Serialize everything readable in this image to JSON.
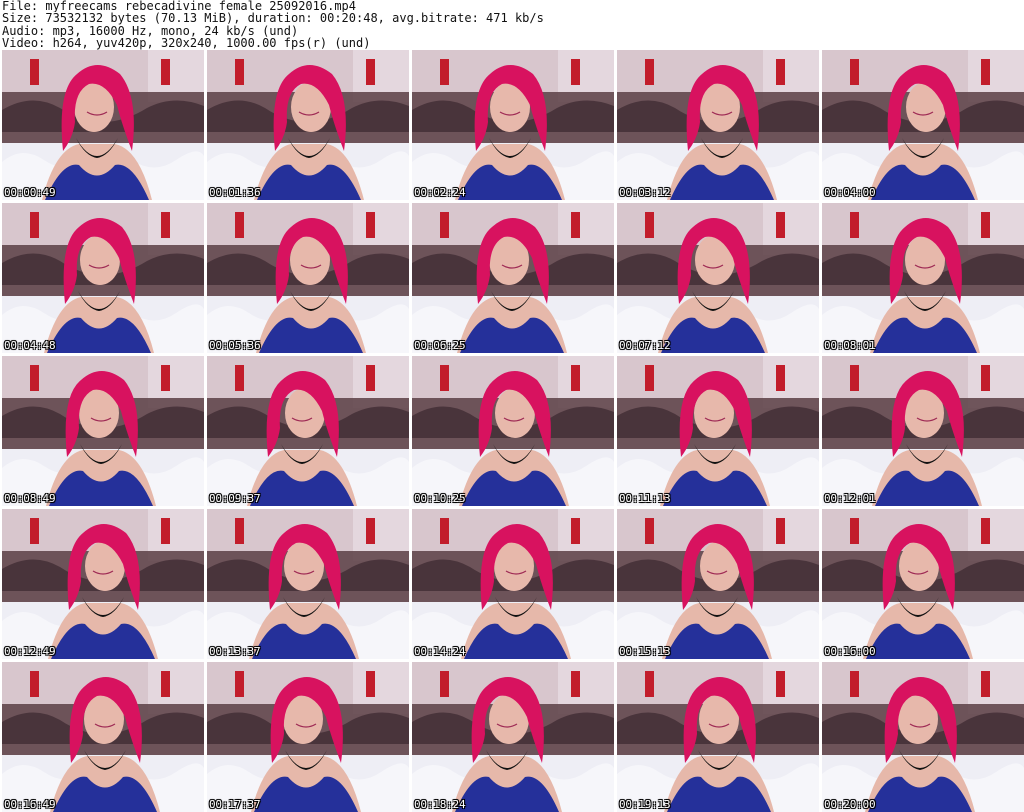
{
  "header": {
    "file_line": "File: myfreecams_rebecadivine_female_25092016.mp4",
    "size_line": "Size: 73532132 bytes (70.13 MiB), duration: 00:20:48, avg.bitrate: 471 kb/s",
    "audio_line": "Audio: mp3, 16000 Hz, mono, 24 kb/s (und)",
    "video_line": "Video: h264, yuv420p, 320x240, 1000.00 fps(r) (und)"
  },
  "thumbnails": [
    {
      "timestamp": "00:00:49"
    },
    {
      "timestamp": "00:01:36"
    },
    {
      "timestamp": "00:02:24"
    },
    {
      "timestamp": "00:03:12"
    },
    {
      "timestamp": "00:04:00"
    },
    {
      "timestamp": "00:04:48"
    },
    {
      "timestamp": "00:05:36"
    },
    {
      "timestamp": "00:06:25"
    },
    {
      "timestamp": "00:07:12"
    },
    {
      "timestamp": "00:08:01"
    },
    {
      "timestamp": "00:08:49"
    },
    {
      "timestamp": "00:09:37"
    },
    {
      "timestamp": "00:10:25"
    },
    {
      "timestamp": "00:11:13"
    },
    {
      "timestamp": "00:12:01"
    },
    {
      "timestamp": "00:12:49"
    },
    {
      "timestamp": "00:13:37"
    },
    {
      "timestamp": "00:14:24"
    },
    {
      "timestamp": "00:15:13"
    },
    {
      "timestamp": "00:16:00"
    },
    {
      "timestamp": "00:16:49"
    },
    {
      "timestamp": "00:17:37"
    },
    {
      "timestamp": "00:18:24"
    },
    {
      "timestamp": "00:19:13"
    },
    {
      "timestamp": "00:20:00"
    }
  ],
  "colors": {
    "wall": "#d8c6cd",
    "headboard": "#5b3e44",
    "bedding": "#eeeef5",
    "hair": "#d8125f",
    "dress": "#25309a",
    "necklace": "#111111",
    "lamp": "#c21d2b"
  }
}
